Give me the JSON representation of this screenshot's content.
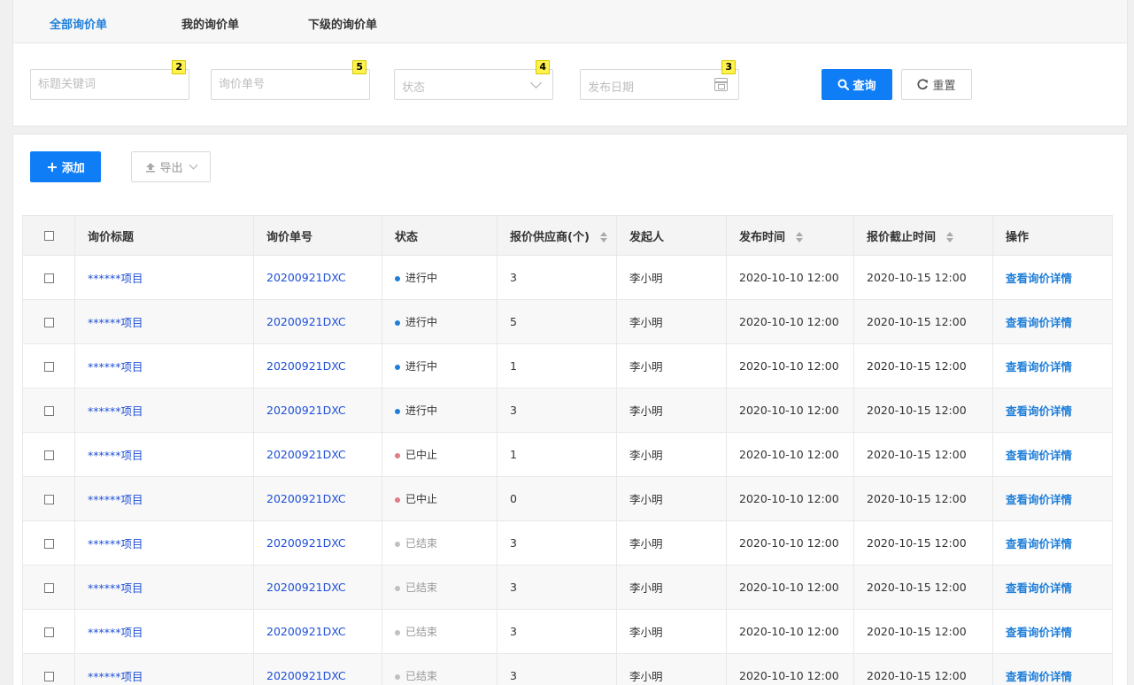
{
  "tabs": [
    {
      "label": "全部询价单",
      "active": true
    },
    {
      "label": "我的询价单",
      "active": false
    },
    {
      "label": "下级的询价单",
      "active": false
    }
  ],
  "filters": {
    "keyword": {
      "placeholder": "标题关键词",
      "badge": "2"
    },
    "number": {
      "placeholder": "询价单号",
      "badge": "5"
    },
    "status": {
      "placeholder": "状态",
      "badge": "4"
    },
    "date": {
      "placeholder": "发布日期",
      "badge": "3"
    },
    "query_label": "查询",
    "reset_label": "重置"
  },
  "toolbar": {
    "add_label": "添加",
    "export_label": "导出"
  },
  "colors": {
    "primary": "#0f7ef6",
    "link": "#1e4fd6",
    "in_progress": "#1e7ed9",
    "stopped": "#e07b86",
    "finished": "#c0c0c0"
  },
  "table": {
    "headers": {
      "title": "询价标题",
      "number": "询价单号",
      "status": "状态",
      "suppliers": "报价供应商(个)",
      "initiator": "发起人",
      "publish_time": "发布时间",
      "deadline": "报价截止时间",
      "action": "操作"
    },
    "rows": [
      {
        "title": "******项目",
        "number": "20200921DXC",
        "status": "进行中",
        "status_color": "#1e7ed9",
        "status_text_color": "#333",
        "suppliers": "3",
        "initiator": "李小明",
        "publish_time": "2020-10-10 12:00",
        "deadline": "2020-10-15 12:00",
        "action": "查看询价详情"
      },
      {
        "title": "******项目",
        "number": "20200921DXC",
        "status": "进行中",
        "status_color": "#1e7ed9",
        "status_text_color": "#333",
        "suppliers": "5",
        "initiator": "李小明",
        "publish_time": "2020-10-10 12:00",
        "deadline": "2020-10-15 12:00",
        "action": "查看询价详情"
      },
      {
        "title": "******项目",
        "number": "20200921DXC",
        "status": "进行中",
        "status_color": "#1e7ed9",
        "status_text_color": "#333",
        "suppliers": "1",
        "initiator": "李小明",
        "publish_time": "2020-10-10 12:00",
        "deadline": "2020-10-15 12:00",
        "action": "查看询价详情"
      },
      {
        "title": "******项目",
        "number": "20200921DXC",
        "status": "进行中",
        "status_color": "#1e7ed9",
        "status_text_color": "#333",
        "suppliers": "3",
        "initiator": "李小明",
        "publish_time": "2020-10-10 12:00",
        "deadline": "2020-10-15 12:00",
        "action": "查看询价详情"
      },
      {
        "title": "******项目",
        "number": "20200921DXC",
        "status": "已中止",
        "status_color": "#e07b86",
        "status_text_color": "#333",
        "suppliers": "1",
        "initiator": "李小明",
        "publish_time": "2020-10-10 12:00",
        "deadline": "2020-10-15 12:00",
        "action": "查看询价详情"
      },
      {
        "title": "******项目",
        "number": "20200921DXC",
        "status": "已中止",
        "status_color": "#e07b86",
        "status_text_color": "#333",
        "suppliers": "0",
        "initiator": "李小明",
        "publish_time": "2020-10-10 12:00",
        "deadline": "2020-10-15 12:00",
        "action": "查看询价详情"
      },
      {
        "title": "******项目",
        "number": "20200921DXC",
        "status": "已结束",
        "status_color": "#c0c0c0",
        "status_text_color": "#999",
        "suppliers": "3",
        "initiator": "李小明",
        "publish_time": "2020-10-10 12:00",
        "deadline": "2020-10-15 12:00",
        "action": "查看询价详情"
      },
      {
        "title": "******项目",
        "number": "20200921DXC",
        "status": "已结束",
        "status_color": "#c0c0c0",
        "status_text_color": "#999",
        "suppliers": "3",
        "initiator": "李小明",
        "publish_time": "2020-10-10 12:00",
        "deadline": "2020-10-15 12:00",
        "action": "查看询价详情"
      },
      {
        "title": "******项目",
        "number": "20200921DXC",
        "status": "已结束",
        "status_color": "#c0c0c0",
        "status_text_color": "#999",
        "suppliers": "3",
        "initiator": "李小明",
        "publish_time": "2020-10-10 12:00",
        "deadline": "2020-10-15 12:00",
        "action": "查看询价详情"
      },
      {
        "title": "******项目",
        "number": "20200921DXC",
        "status": "已结束",
        "status_color": "#c0c0c0",
        "status_text_color": "#999",
        "suppliers": "3",
        "initiator": "李小明",
        "publish_time": "2020-10-10 12:00",
        "deadline": "2020-10-15 12:00",
        "action": "查看询价详情"
      }
    ]
  }
}
